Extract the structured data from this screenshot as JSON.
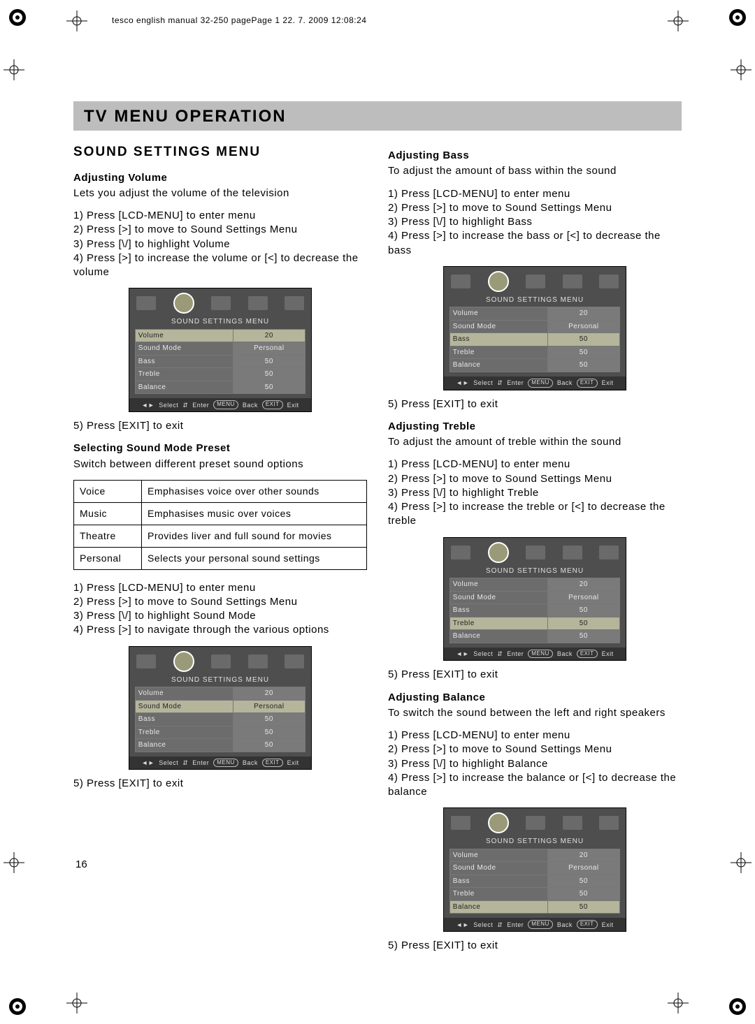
{
  "fineprint": "tesco english manual 32-250 pagePage 1   22. 7. 2009   12:08:24",
  "titlebar": "Tv Menu Operation",
  "sound_heading": "Sound Settings Menu",
  "pagenum": "16",
  "left": {
    "vol_h": "Adjusting Volume",
    "vol_p": "Lets you adjust the volume of the television",
    "vol_steps": "1) Press [LCD-MENU] to enter menu\n2) Press [>] to move to Sound Settings Menu\n3) Press [\\/] to highlight Volume\n4) Press [>] to increase the volume or [<] to decrease the volume",
    "vol_exit": "5) Press [EXIT] to exit",
    "mode_h": "Selecting Sound Mode Preset",
    "mode_p": "Switch between different preset sound options",
    "presets": [
      [
        "Voice",
        "Emphasises voice over other sounds"
      ],
      [
        "Music",
        "Emphasises music over voices"
      ],
      [
        "Theatre",
        "Provides liver and full sound for movies"
      ],
      [
        "Personal",
        "Selects your personal sound settings"
      ]
    ],
    "mode_steps": "1) Press [LCD-MENU] to enter menu\n2) Press [>] to move to Sound Settings Menu\n3) Press [\\/] to highlight Sound Mode\n4) Press [>] to navigate through the various options",
    "mode_exit": "5) Press [EXIT] to exit"
  },
  "right": {
    "bass_h": "Adjusting Bass",
    "bass_p": "To adjust the amount of bass within the sound",
    "bass_steps": "1) Press [LCD-MENU] to enter menu\n2) Press [>] to move to Sound Settings Menu\n3) Press [\\/] to highlight Bass\n4) Press [>] to increase the bass or [<] to decrease the bass",
    "bass_exit": "5) Press [EXIT] to exit",
    "treble_h": "Adjusting Treble",
    "treble_p": "To adjust the amount of treble within the sound",
    "treble_steps": "1) Press [LCD-MENU] to enter menu\n2) Press [>] to move to Sound Settings Menu\n3) Press [\\/] to highlight Treble\n4) Press [>] to increase the treble or [<] to decrease the treble",
    "treble_exit": "5) Press [EXIT] to exit",
    "bal_h": "Adjusting Balance",
    "bal_p": "To switch the sound between the left and right speakers",
    "bal_steps": "1) Press [LCD-MENU] to enter menu\n2) Press [>] to move to Sound Settings Menu\n3) Press [\\/] to highlight Balance\n4) Press [>] to increase the balance or [<] to decrease the balance",
    "bal_exit": "5) Press [EXIT] to exit"
  },
  "tvmenu": {
    "title": "SOUND SETTINGS MENU",
    "rows": [
      {
        "label": "Volume",
        "value": "20"
      },
      {
        "label": "Sound Mode",
        "value": "Personal"
      },
      {
        "label": "Bass",
        "value": "50"
      },
      {
        "label": "Treble",
        "value": "50"
      },
      {
        "label": "Balance",
        "value": "50"
      }
    ],
    "footer_select": "Select",
    "footer_enter": "Enter",
    "footer_menu": "MENU",
    "footer_back": "Back",
    "footer_exitpill": "EXIT",
    "footer_exit": "Exit"
  }
}
